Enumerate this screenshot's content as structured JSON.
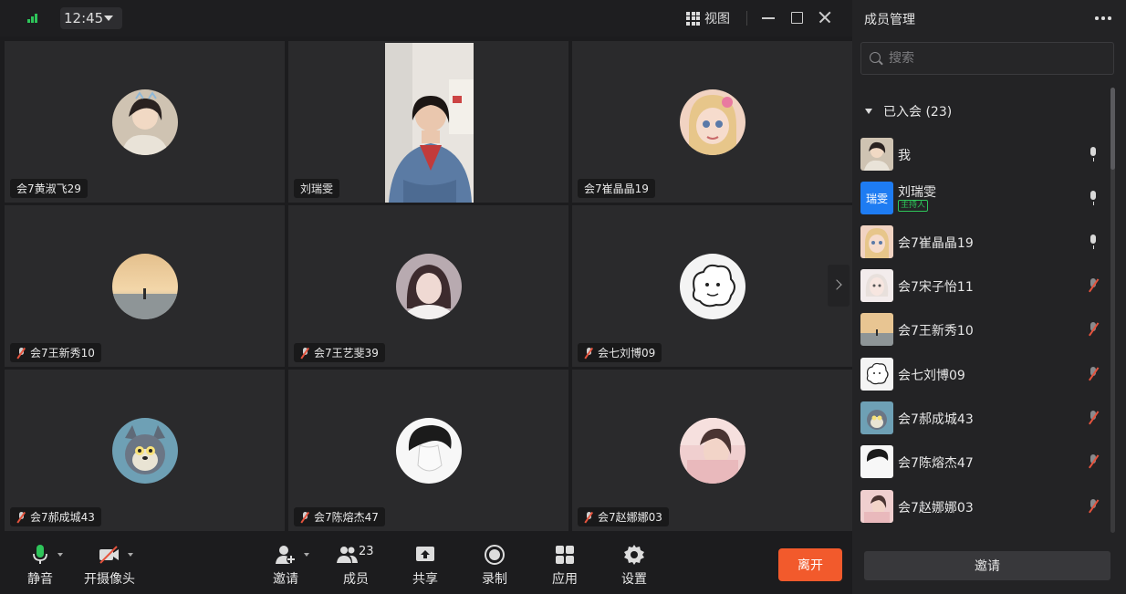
{
  "titlebar": {
    "time": "12:45",
    "view_label": "视图"
  },
  "tiles": [
    {
      "name": "会7黄淑飞29",
      "muted": false
    },
    {
      "name": "刘瑞雯",
      "muted": false
    },
    {
      "name": "会7崔晶晶19",
      "muted": false
    },
    {
      "name": "会7王新秀10",
      "muted": true
    },
    {
      "name": "会7王艺斐39",
      "muted": true
    },
    {
      "name": "会七刘博09",
      "muted": true
    },
    {
      "name": "会7郝成城43",
      "muted": true
    },
    {
      "name": "会7陈熔杰47",
      "muted": true
    },
    {
      "name": "会7赵娜娜03",
      "muted": true
    }
  ],
  "toolbar": {
    "mute_label": "静音",
    "camera_label": "开摄像头",
    "invite_label": "邀请",
    "members_label": "成员",
    "members_count": "23",
    "share_label": "共享",
    "record_label": "录制",
    "apps_label": "应用",
    "settings_label": "设置",
    "leave_label": "离开"
  },
  "panel": {
    "title": "成员管理",
    "search_placeholder": "搜索",
    "section_label": "已入会 (23)",
    "avatar_initials": "瑞雯",
    "host_badge": "主持人",
    "invite_button": "邀请",
    "members": [
      {
        "name": "我",
        "mic": "on"
      },
      {
        "name": "刘瑞雯",
        "mic": "on",
        "host": true
      },
      {
        "name": "会7崔晶晶19",
        "mic": "on"
      },
      {
        "name": "会7宋子怡11",
        "mic": "off"
      },
      {
        "name": "会7王新秀10",
        "mic": "off"
      },
      {
        "name": "会七刘博09",
        "mic": "off"
      },
      {
        "name": "会7郝成城43",
        "mic": "off"
      },
      {
        "name": "会7陈熔杰47",
        "mic": "off"
      },
      {
        "name": "会7赵娜娜03",
        "mic": "off"
      }
    ]
  },
  "colors": {
    "accent_leave": "#f25a2c",
    "host_badge": "#2ec55a",
    "muted_slash": "#e5533d"
  }
}
